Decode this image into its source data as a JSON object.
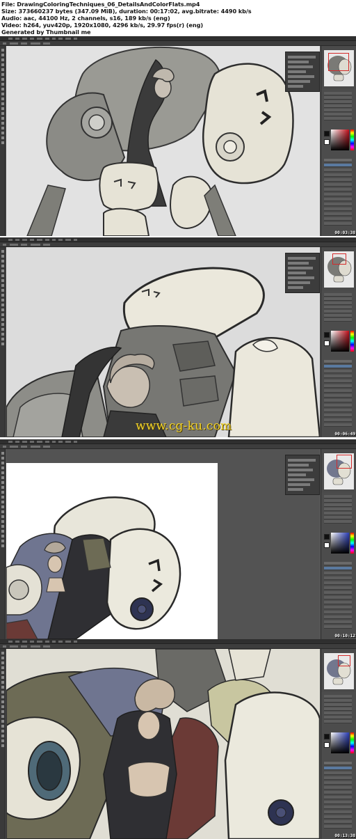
{
  "header": {
    "file_line": "File: DrawingColoringTechniques_06_DetailsAndColorFlats.mp4",
    "size_line": "Size: 373660237 bytes (347.09 MiB), duration: 00:17:02, avg.bitrate: 4490 kb/s",
    "audio_line": "Audio: aac, 44100 Hz, 2 channels, s16, 189 kb/s (eng)",
    "video_line": "Video: h264, yuv420p, 1920x1080, 4296 kb/s, 29.97 fps(r) (eng)",
    "generated_line": "Generated by Thumbnail me"
  },
  "frames": [
    {
      "timestamp": "00:03:38",
      "view": "Full mech sketch, line art"
    },
    {
      "timestamp": "00:06:49",
      "view": "Zoomed helmet detail"
    },
    {
      "timestamp": "00:10:12",
      "view": "Color flats, document window"
    },
    {
      "timestamp": "00:13:38",
      "view": "Color flats close-up"
    }
  ],
  "watermark": "www.cg-ku.com",
  "colors": {
    "photoshop_dark": "#2f2f2f",
    "panel_grey": "#4c4c4c",
    "canvas_bg": "#dfdfdf",
    "armor_cream": "#e6e3d6",
    "armor_grey": "#8e8e86",
    "suit_dark": "#3a3a3a",
    "flat_slate": "#6f7590",
    "flat_olive": "#6d6b55",
    "flat_red": "#6b3a36",
    "skin": "#d7c5b0",
    "watermark_yellow": "#f2d32a",
    "nav_red": "#d42a2a"
  }
}
